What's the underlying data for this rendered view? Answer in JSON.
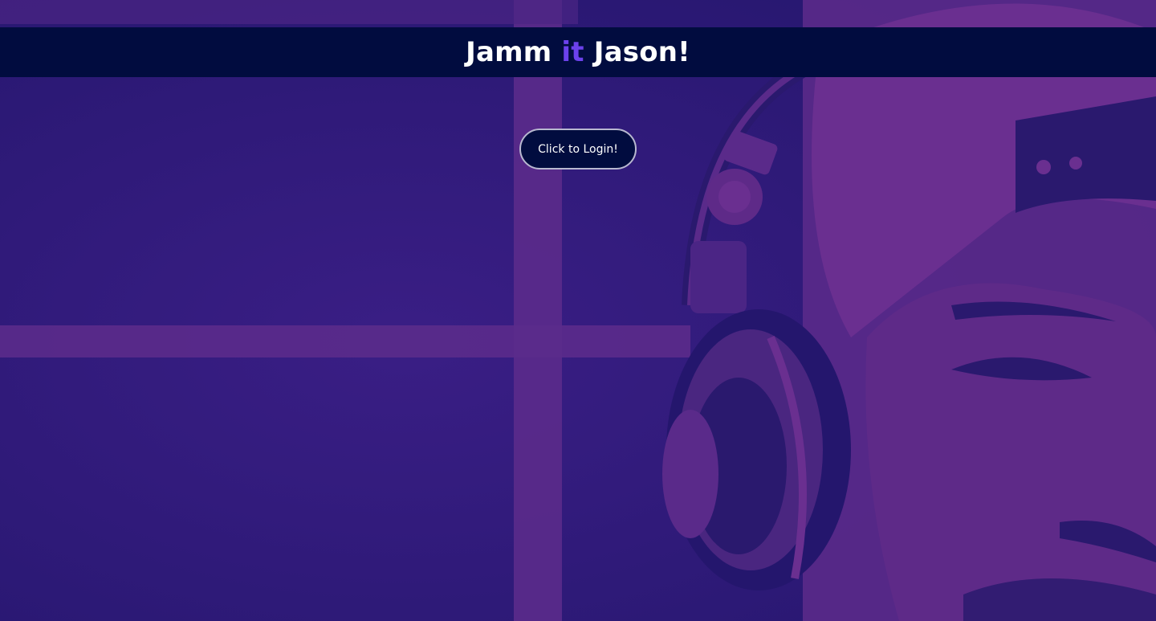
{
  "header": {
    "title_part1": "Jamm ",
    "title_accent": "it",
    "title_part2": " Jason!"
  },
  "login": {
    "button_label": "Click to Login!"
  },
  "background": {
    "description": "purple-tinted photo of a man with backwards cap and DJ headphones",
    "tint_color": "#2c1a7a",
    "highlight_color": "#5a2a8a"
  },
  "colors": {
    "header_bg": "#010c3f",
    "accent": "#6c41ec",
    "text": "#ffffff"
  }
}
